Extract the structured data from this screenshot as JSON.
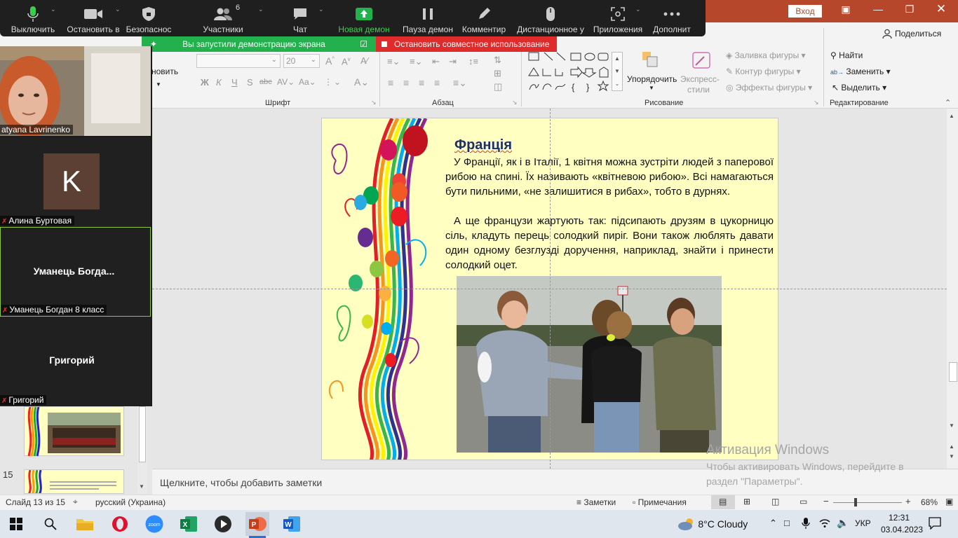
{
  "app": {
    "accent": "#b7472a",
    "signin_label": "Вход",
    "share_label": "Поделиться"
  },
  "zoom_toolbar": {
    "buttons": [
      {
        "label": "Выключить",
        "icon": "microphone-icon"
      },
      {
        "label": "Остановить в",
        "icon": "video-camera-icon"
      },
      {
        "label": "Безопаснос",
        "icon": "shield-icon"
      },
      {
        "label": "Участники",
        "icon": "participants-icon",
        "count": "6"
      },
      {
        "label": "Чат",
        "icon": "chat-icon"
      },
      {
        "label": "Новая демон",
        "icon": "share-screen-icon"
      },
      {
        "label": "Пауза демон",
        "icon": "pause-icon"
      },
      {
        "label": "Комментир",
        "icon": "annotate-pen-icon"
      },
      {
        "label": "Дистанционное у",
        "icon": "remote-control-icon"
      },
      {
        "label": "Приложения",
        "icon": "apps-icon"
      },
      {
        "label": "Дополнит",
        "icon": "more-icon"
      }
    ],
    "share_banner": "Вы запустили демонстрацию экрана",
    "stop_share": "Остановить совместное использование"
  },
  "ribbon": {
    "font_group": "Шрифт",
    "paragraph_group": "Абзац",
    "drawing_group": "Рисование",
    "editing_group": "Редактирование",
    "font_size": "20",
    "partial_label": "новить",
    "arrange": "Упорядочить",
    "express_styles_1": "Экспресс-",
    "express_styles_2": "стили",
    "shape_fill": "Заливка фигуры",
    "shape_outline": "Контур фигуры",
    "shape_effects": "Эффекты фигуры",
    "find": "Найти",
    "replace": "Заменить",
    "select": "Выделить"
  },
  "participants": [
    {
      "name": "atyana Lavrinenko",
      "type": "video"
    },
    {
      "name": "Алина Буртовая",
      "avatar_letter": "K",
      "avatar_color": "#5c4033",
      "type": "avatar"
    },
    {
      "name": "Уманець Богдан 8 класс",
      "center_label": "Уманець Богда...",
      "type": "name",
      "active": true
    },
    {
      "name": "Григорий",
      "center_label": "Григорий",
      "type": "name"
    }
  ],
  "slide": {
    "title": "Франція",
    "p1": "У Франції, як і в Італії, 1 квітня можна зустріти людей з паперової рибою на спині. Їх називають «квітневою рибою». Всі намагаються бути пильними, «не залишитися в рибах», тобто в дурнях.",
    "p2": "А ще французи жартують так: підсипають друзям в цукорницю сіль, кладуть перець солодкий пиріг. Вони також люблять давати один одному безглузді доручення, наприклад, знайти і принести солодкий оцет."
  },
  "thumbnails": {
    "slide15_num": "15"
  },
  "notes_placeholder": "Щелкните, чтобы добавить заметки",
  "status": {
    "slide_info": "Слайд 13 из 15",
    "language": "русский (Украина)",
    "notes": "Заметки",
    "comments": "Примечания",
    "zoom": "68%",
    "zoom_fraction": 0.55
  },
  "watermark": {
    "title": "Активация Windows",
    "line1": "Чтобы активировать Windows, перейдите в",
    "line2": "раздел \"Параметры\"."
  },
  "taskbar": {
    "weather": "8°C  Cloudy",
    "lang": "УКР",
    "time": "12:31",
    "date": "03.04.2023"
  }
}
